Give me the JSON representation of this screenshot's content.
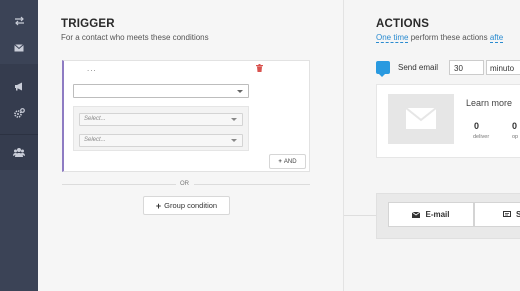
{
  "sidebar": {
    "items": [
      {
        "icon": "swap-arrows-icon"
      },
      {
        "icon": "envelope-icon"
      },
      {
        "icon": "megaphone-icon"
      },
      {
        "icon": "cogs-icon"
      },
      {
        "icon": "users-icon"
      }
    ]
  },
  "trigger": {
    "title": "TRIGGER",
    "subtitle": "For a contact who meets these conditions",
    "condition_dots": "...",
    "select_main_value": "",
    "sub_selects": [
      {
        "placeholder": "Select..."
      },
      {
        "placeholder": "Select..."
      }
    ],
    "and_label": "AND",
    "or_label": "OR",
    "group_condition_label": "Group condition"
  },
  "actions": {
    "title": "ACTIONS",
    "subtitle_link": "One time",
    "subtitle_rest": " perform these actions ",
    "subtitle_link2": "afte",
    "send_email_label": "Send email",
    "delay_value": "30",
    "delay_unit": "minuto",
    "learn_more": "Learn more",
    "stats": [
      {
        "value": "0",
        "label": "deliver"
      },
      {
        "value": "0",
        "label": "op"
      }
    ],
    "tabs": [
      {
        "label": "E-mail",
        "icon": "envelope-icon"
      },
      {
        "label": "S",
        "icon": "sms-icon"
      }
    ],
    "accent_color": "#2a8bd0"
  },
  "colors": {
    "sidebar_bg": "#3b4356",
    "condition_border": "#8e7cc3"
  }
}
